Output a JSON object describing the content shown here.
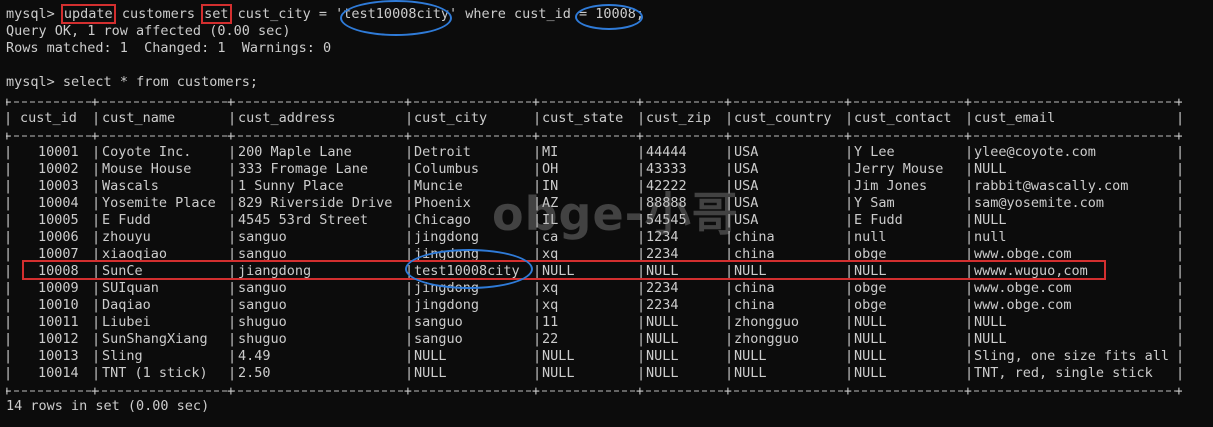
{
  "prompt": "mysql>",
  "command": {
    "kw_update": "update",
    "part1": " customers ",
    "kw_set": "set",
    "part2": " cust_city = '",
    "value_city": "test10008city",
    "part3": "' where cust_id = ",
    "value_id": "10008;"
  },
  "messages": {
    "query_ok": "Query OK, 1 row affected (0.00 sec)",
    "rows_matched": "Rows matched: 1  Changed: 1  Warnings: 0"
  },
  "select_command": "select * from customers;",
  "table": {
    "columns": [
      "cust_id",
      "cust_name",
      "cust_address",
      "cust_city",
      "cust_state",
      "cust_zip",
      "cust_country",
      "cust_contact",
      "cust_email"
    ],
    "rows": [
      [
        "10001",
        "Coyote Inc.",
        "200 Maple Lane",
        "Detroit",
        "MI",
        "44444",
        "USA",
        "Y Lee",
        "ylee@coyote.com"
      ],
      [
        "10002",
        "Mouse House",
        "333 Fromage Lane",
        "Columbus",
        "OH",
        "43333",
        "USA",
        "Jerry Mouse",
        "NULL"
      ],
      [
        "10003",
        "Wascals",
        "1 Sunny Place",
        "Muncie",
        "IN",
        "42222",
        "USA",
        "Jim Jones",
        "rabbit@wascally.com"
      ],
      [
        "10004",
        "Yosemite Place",
        "829 Riverside Drive",
        "Phoenix",
        "AZ",
        "88888",
        "USA",
        "Y Sam",
        "sam@yosemite.com"
      ],
      [
        "10005",
        "E Fudd",
        "4545 53rd Street",
        "Chicago",
        "IL",
        "54545",
        "USA",
        "E Fudd",
        "NULL"
      ],
      [
        "10006",
        "zhouyu",
        "sanguo",
        "jingdong",
        "ca",
        "1234",
        "china",
        "null",
        "null"
      ],
      [
        "10007",
        "xiaoqiao",
        "sanguo",
        "jingdong",
        "xq",
        "2234",
        "china",
        "obge",
        "www.obge.com"
      ],
      [
        "10008",
        "SunCe",
        "jiangdong",
        "test10008city",
        "NULL",
        "NULL",
        "NULL",
        "NULL",
        "wwww.wuguo,com"
      ],
      [
        "10009",
        "SUIquan",
        "sanguo",
        "jingdong",
        "xq",
        "2234",
        "china",
        "obge",
        "www.obge.com"
      ],
      [
        "10010",
        "Daqiao",
        "sanguo",
        "jingdong",
        "xq",
        "2234",
        "china",
        "obge",
        "www.obge.com"
      ],
      [
        "10011",
        "Liubei",
        "shuguo",
        "sanguo",
        "11",
        "NULL",
        "zhongguo",
        "NULL",
        "NULL"
      ],
      [
        "10012",
        "SunShangXiang",
        "shuguo",
        "sanguo",
        "22",
        "NULL",
        "zhongguo",
        "NULL",
        "NULL"
      ],
      [
        "10013",
        "Sling",
        "4.49",
        "NULL",
        "NULL",
        "NULL",
        "NULL",
        "NULL",
        "Sling, one size fits all"
      ],
      [
        "10014",
        "TNT (1 stick)",
        "2.50",
        "NULL",
        "NULL",
        "NULL",
        "NULL",
        "NULL",
        "TNT, red, single stick"
      ]
    ]
  },
  "footer": "14 rows in set (0.00 sec)",
  "watermark": "obge-小哥"
}
